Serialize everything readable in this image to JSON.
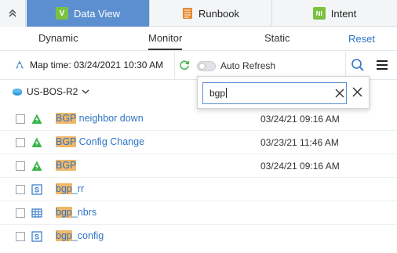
{
  "tabs": {
    "data_view": {
      "label": "Data View",
      "icon_text": "V"
    },
    "runbook": {
      "label": "Runbook"
    },
    "intent": {
      "label": "Intent",
      "icon_text": "NI"
    }
  },
  "subtabs": {
    "dynamic": "Dynamic",
    "monitor": "Monitor",
    "static": "Static",
    "reset": "Reset"
  },
  "map_time": "Map time: 03/24/2021 10:30 AM",
  "auto_refresh": {
    "label": "Auto Refresh",
    "on": false
  },
  "device": "US-BOS-R2",
  "search": {
    "value": "bgp"
  },
  "results": [
    {
      "type": "alert",
      "highlight": "BGP",
      "rest": " neighbor down",
      "date": "03/24/21 09:16 AM"
    },
    {
      "type": "alert",
      "highlight": "BGP",
      "rest": " Config Change",
      "date": "03/23/21 11:46 AM"
    },
    {
      "type": "alert",
      "highlight": "BGP",
      "rest": "",
      "date": "03/24/21 09:16 AM"
    },
    {
      "type": "script",
      "highlight": "bgp",
      "rest": "_rr",
      "date": ""
    },
    {
      "type": "table",
      "highlight": "bgp",
      "rest": "_nbrs",
      "date": ""
    },
    {
      "type": "script",
      "highlight": "bgp",
      "rest": "_config",
      "date": ""
    }
  ],
  "colors": {
    "active_tab": "#5b8fd0",
    "link": "#2f75c4",
    "highlight": "#f1b768",
    "alert_green": "#3bb44a",
    "intent_green": "#7cc142",
    "runbook_orange": "#e58a2e"
  }
}
